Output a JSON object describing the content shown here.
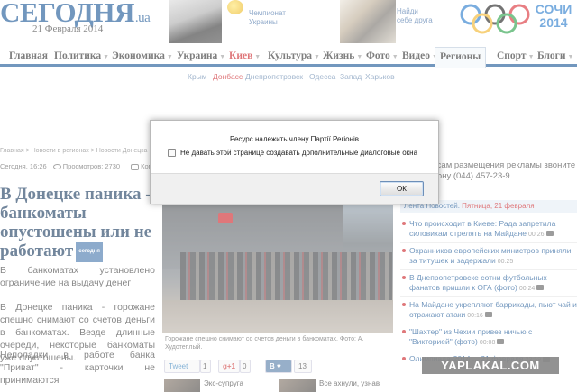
{
  "site": {
    "logo": "СЕГОДНЯ",
    "logo_tld": ".ua",
    "date": "21 Февраля 2014",
    "promo_left": "Чемпионат Украины",
    "promo_right": "Найди себе друга",
    "sochi_label": "СОЧИ 2014"
  },
  "nav": {
    "items": [
      {
        "label": "Главная",
        "dropdown": false
      },
      {
        "label": "Политика",
        "dropdown": true
      },
      {
        "label": "Экономика",
        "dropdown": true
      },
      {
        "label": "Украина",
        "dropdown": true
      },
      {
        "label": "Киев",
        "dropdown": true,
        "highlight": "red"
      },
      {
        "label": "Культура",
        "dropdown": true
      },
      {
        "label": "Жизнь",
        "dropdown": true
      },
      {
        "label": "Фото",
        "dropdown": true
      },
      {
        "label": "Видео",
        "dropdown": true
      },
      {
        "label": "Регионы",
        "dropdown": false,
        "active": true
      },
      {
        "label": "Спорт",
        "dropdown": true
      },
      {
        "label": "Блоги",
        "dropdown": true
      }
    ],
    "sub_items": [
      "Крым",
      "Донбасс",
      "Днепропетровск",
      "Одесса",
      "Запад",
      "Харьков"
    ],
    "sub_active": "Донбасс"
  },
  "article": {
    "breadcrumb": "Главная  >  Новости в регионах  >  Новости Донецка",
    "time": "Сегодня, 16:26",
    "views": "Просмотров: 2730",
    "comments_abbr": "Ком",
    "headline": "В Донецке паника - банкоматы опустошены или не работают",
    "tag": "сегодня",
    "lead1": "В банкоматах установлено ограничение на выдачу денег",
    "lead2": "В Донецке паника - горожане спешно снимают со счетов деньги в банкоматах. Везде длинные очереди, некоторые банкоматы уже опустошены.",
    "lead3": "Неполадки в работе банка \"Приват\" - карточки не принимаются",
    "photo_caption": "Горожане спешно снимают со счетов деньги в банкоматах. Фото: А. Худотеплый.",
    "share": {
      "tweet": "Tweet",
      "tweet_count": "1",
      "gplus": "g+1",
      "gplus_count": "0",
      "vk": "В",
      "vk_count": "13"
    },
    "bottom_left": "Экс-супруга",
    "bottom_right": "Все ахнули, узнав"
  },
  "sidebar": {
    "ad_text": "По вопросам размещения рекламы звоните по телефону (044) 457-23-9",
    "news_header_label": "Лента Новостей.",
    "news_header_date": "Пятница, 21 февраля",
    "news": [
      {
        "text": "Что происходит в Киеве: Рада запретила силовикам стрелять на Майдане",
        "time": "00:26",
        "camera": true
      },
      {
        "text": "Охранников европейских министров приняли за титушек и задержали",
        "time": "00:25",
        "camera": false
      },
      {
        "text": "В Днепропетровске сотни футбольных фанатов пришли к ОГА (фото)",
        "time": "00:24",
        "camera": true
      },
      {
        "text": "На Майдане укрепляют баррикады, пьют чай и отражают атаки",
        "time": "00:16",
        "camera": true
      },
      {
        "text": "\"Шахтер\" из Чехии привез ничью с \"Викторией\" (фото)",
        "time": "00:08",
        "camera": true
      },
      {
        "text": "Олимпиада-2014 ... 21 февраля",
        "time": "23:59",
        "camera": true
      }
    ]
  },
  "dialog": {
    "title": "Ресурс належить члену Партії Регіонів",
    "checkbox_label": "Не давать этой странице создавать дополнительные диалоговые окна",
    "checkbox_checked": false,
    "ok_label": "ОК"
  },
  "watermark": "YAPLAKAL.COM"
}
